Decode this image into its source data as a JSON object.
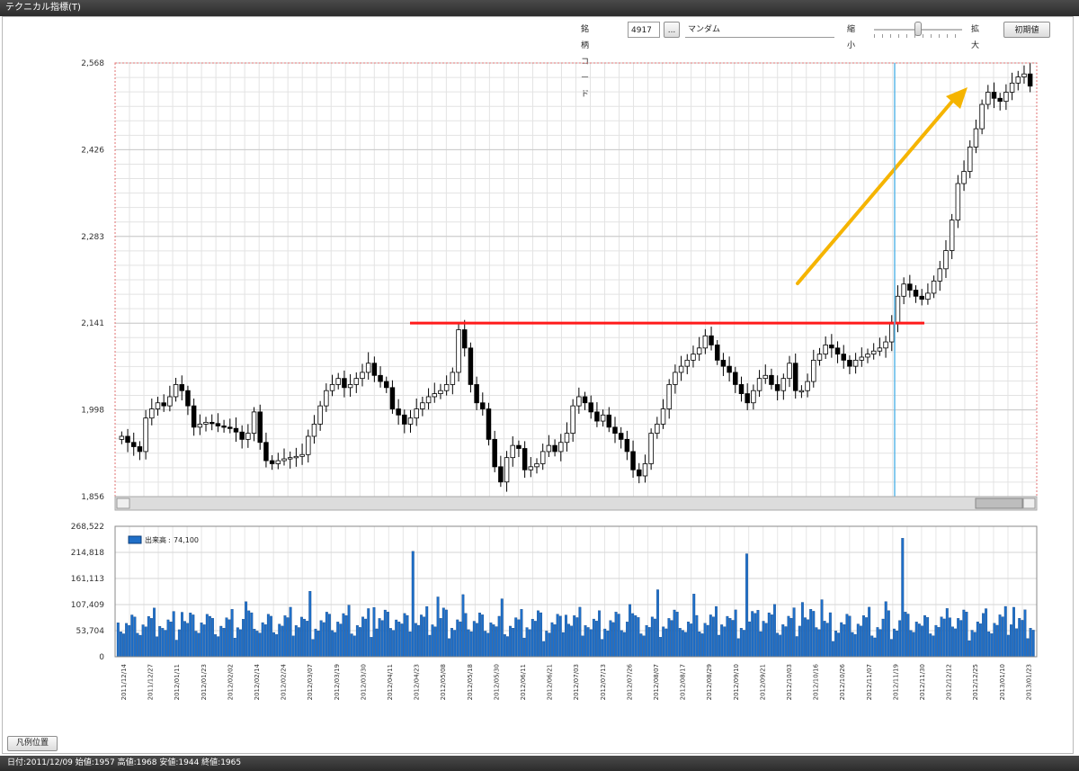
{
  "window": {
    "title": "テクニカル指標(T)"
  },
  "toolbar": {
    "code_label": "銘柄コード:",
    "code_value": "4917",
    "lookup_button": "...",
    "name_value": "マンダム",
    "zoom_out_label": "縮小",
    "zoom_in_label": "拡大",
    "zoom_level": 0.5,
    "reset_button": "初期値"
  },
  "legend_position_button": "凡例位置",
  "status": {
    "text": "日付:2011/12/09 始値:1957 高値:1968 安値:1944 終値:1965"
  },
  "colors": {
    "up_candle": "#ffffff",
    "down_candle": "#000000",
    "resistance_line": "#ff1a1a",
    "trend_arrow": "#f5b400",
    "cursor_line": "#5fb8e8",
    "volume_bar": "#1f6fc8"
  },
  "chart_data": [
    {
      "type": "candlestick",
      "y_ticks": [
        "2,568",
        "2,426",
        "2,283",
        "2,141",
        "1,998",
        "1,856"
      ],
      "ylim": [
        1856,
        2568
      ],
      "grid": true,
      "series_close": [
        1955,
        1945,
        1938,
        1930,
        1985,
        2000,
        2010,
        2005,
        2020,
        2040,
        2030,
        2005,
        1970,
        1975,
        1978,
        1976,
        1972,
        1970,
        1968,
        1962,
        1950,
        1960,
        1995,
        1945,
        1915,
        1910,
        1915,
        1918,
        1920,
        1922,
        1925,
        1955,
        1975,
        2005,
        2030,
        2040,
        2050,
        2035,
        2040,
        2050,
        2060,
        2075,
        2055,
        2045,
        2035,
        2000,
        1990,
        1975,
        1985,
        2000,
        2010,
        2020,
        2025,
        2030,
        2040,
        2060,
        2130,
        2100,
        2040,
        2010,
        2000,
        1950,
        1905,
        1880,
        1920,
        1940,
        1935,
        1900,
        1905,
        1910,
        1930,
        1940,
        1930,
        1945,
        1960,
        2005,
        2020,
        2010,
        1995,
        1980,
        1990,
        1970,
        1960,
        1950,
        1930,
        1900,
        1890,
        1910,
        1960,
        1975,
        2000,
        2040,
        2060,
        2070,
        2080,
        2090,
        2100,
        2120,
        2105,
        2080,
        2070,
        2060,
        2040,
        2025,
        2010,
        2030,
        2050,
        2055,
        2040,
        2030,
        2050,
        2075,
        2030,
        2030,
        2045,
        2080,
        2090,
        2105,
        2100,
        2090,
        2080,
        2070,
        2080,
        2085,
        2090,
        2095,
        2100,
        2110,
        2140,
        2185,
        2205,
        2195,
        2185,
        2180,
        2190,
        2210,
        2230,
        2260,
        2310,
        2370,
        2390,
        2430,
        2460,
        2500,
        2520,
        2510,
        2505,
        2520,
        2535,
        2545,
        2550,
        2530
      ],
      "resistance_level": 2141,
      "cursor_date": "2011/12/09"
    },
    {
      "type": "bar",
      "name": "出来高",
      "current_value": "74,100",
      "y_ticks": [
        "268,522",
        "214,818",
        "161,113",
        "107,409",
        "53,704",
        "0"
      ],
      "ylim": [
        0,
        268522
      ],
      "grid": true,
      "x_ticks": [
        "2011/12/14",
        "2011/12/27",
        "2012/01/11",
        "2012/01/23",
        "2012/02/02",
        "2012/02/14",
        "2012/02/24",
        "2012/03/07",
        "2012/03/19",
        "2012/03/30",
        "2012/04/11",
        "2012/04/23",
        "2012/05/08",
        "2012/05/18",
        "2012/05/30",
        "2012/06/11",
        "2012/06/21",
        "2012/07/03",
        "2012/07/13",
        "2012/07/26",
        "2012/08/07",
        "2012/08/17",
        "2012/08/29",
        "2012/09/10",
        "2012/09/21",
        "2012/10/03",
        "2012/10/16",
        "2012/10/26",
        "2012/11/07",
        "2012/11/19",
        "2012/11/30",
        "2012/12/12",
        "2012/12/25",
        "2013/01/10",
        "2013/01/23"
      ]
    }
  ]
}
